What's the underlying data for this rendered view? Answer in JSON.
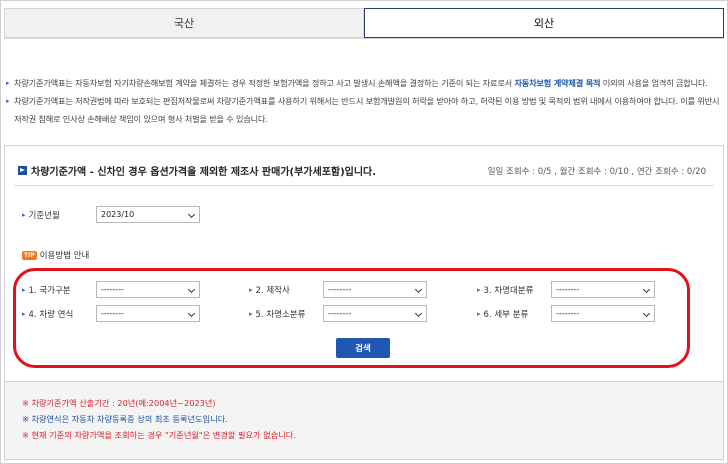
{
  "tabs": [
    {
      "label": "국산",
      "active": false
    },
    {
      "label": "외산",
      "active": true
    }
  ],
  "notices": {
    "line1a": "차량기준가액표는 자동차보험 자기차량손해보험 계약을 체결하는 경우 적정한 보험가액을 정하고 사고 발생시 손해액을 결정하는 기준이 되는 자료로서 ",
    "line1b": "자동차보험 계약체결 목적",
    "line1c": " 이외의 사용을 엄격히 금합니다.",
    "line2": "차량기준가액표는 저작권법에 따라 보호되는 편집저작물로써 차량기준가액표를 사용하기 위해서는 반드시 보험개발원의 허락을 받아야 하고, 허락된 이용 방법 및 목적의 범위 내에서 이용하여야 합니다. 이를 위반시 저작권 침해로 인사상 손해배상 책임이 있으며 형사 처벌을 받을 수 있습니다."
  },
  "panel": {
    "title": "차량기준가액 - 신차인 경우 옵션가격을 제외한 제조사 판매가(부가세포함)입니다.",
    "counts": "일일 조회수 : 0/5 , 월간 조회수 : 0/10 , 연간 조회수 : 0/20",
    "base_month_label": "기준년월",
    "base_month_value": "2023/10",
    "tip_badge": "TIP",
    "tip_label": "이용방법 안내",
    "search_label": "검색"
  },
  "filters": [
    {
      "label": "1. 국가구분",
      "value": "--------"
    },
    {
      "label": "2. 제작사",
      "value": "--------"
    },
    {
      "label": "3. 차명대분류",
      "value": "--------"
    },
    {
      "label": "4. 차량 연식",
      "value": "--------"
    },
    {
      "label": "5. 차명소분류",
      "value": "--------"
    },
    {
      "label": "6. 세부 분류",
      "value": "--------"
    }
  ],
  "footer": {
    "note1": "※ 차량기준가액 산출기간 : 20년(예:2004년~2023년)",
    "note2": "※ 차량연식은 자동차 차량등록증 상의 최초 등록년도입니다.",
    "note3": "※ 현재 기준의 차량가액을 조회하는 경우 \"기준년월\"은 변경할 필요가 없습니다."
  },
  "colors": {
    "accent": "#1f57b3",
    "highlight": "#e0121a",
    "warning": "#d8232a"
  }
}
